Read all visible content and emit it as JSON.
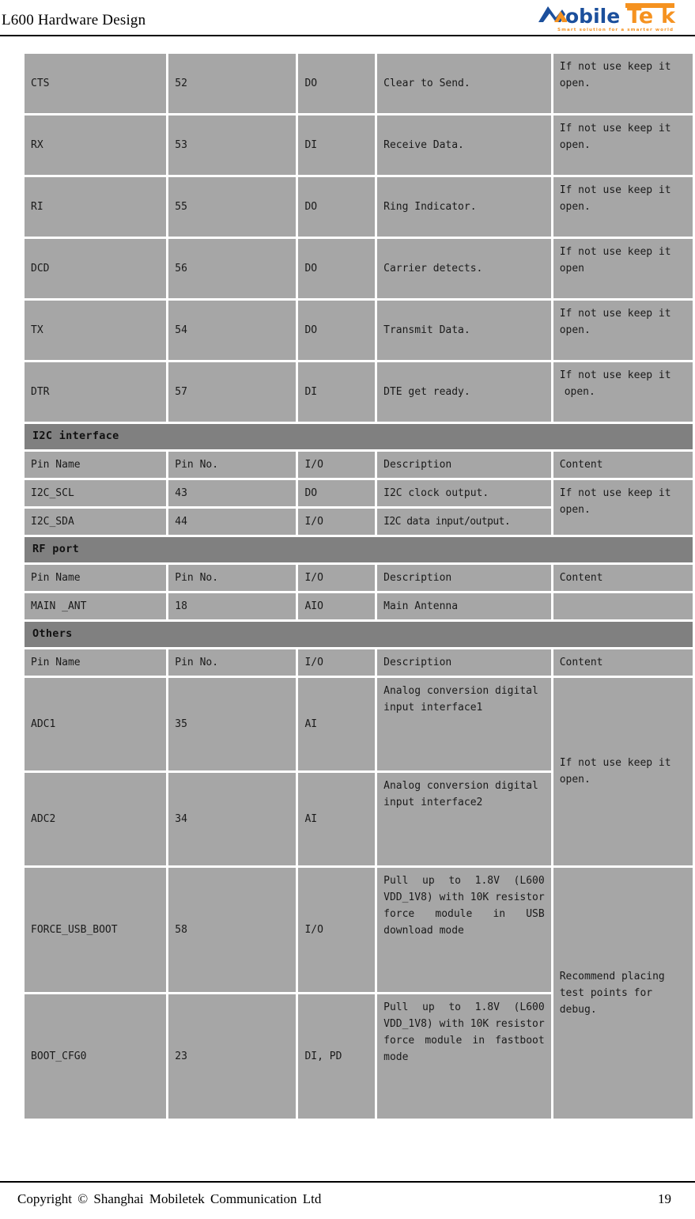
{
  "header": {
    "title": "L600 Hardware Design",
    "logo": {
      "name": "mobiletek-logo",
      "word_mobile": "obile",
      "word_tek": "Tek",
      "tagline": "Smart solution for a smarter world",
      "color_blue": "#1b4f9c",
      "color_orange": "#f59220"
    }
  },
  "table": {
    "columns": [
      "Pin Name",
      "Pin No.",
      "I/O",
      "Description",
      "Content"
    ],
    "uart_rows": [
      {
        "pin_name": "CTS",
        "pin_no": "52",
        "io": "DO",
        "description": "Clear to Send.",
        "content": "If not use keep it open."
      },
      {
        "pin_name": "RX",
        "pin_no": "53",
        "io": "DI",
        "description": "Receive Data.",
        "content": "If not use keep it open."
      },
      {
        "pin_name": "RI",
        "pin_no": "55",
        "io": "DO",
        "description": "Ring Indicator.",
        "content": "If not use keep it open."
      },
      {
        "pin_name": "DCD",
        "pin_no": "56",
        "io": "DO",
        "description": "Carrier detects.",
        "content": "If not use keep it open"
      },
      {
        "pin_name": "TX",
        "pin_no": "54",
        "io": "DO",
        "description": "Transmit Data.",
        "content": "If not use keep it open."
      },
      {
        "pin_name": "DTR",
        "pin_no": "57",
        "io": "DI",
        "description": "DTE get ready.",
        "content_line1": "If not use keep it",
        "content_line2": "open."
      }
    ],
    "sections": [
      {
        "title": "I2C interface",
        "rows": [
          {
            "pin_name": "I2C_SCL",
            "pin_no": "43",
            "io": "DO",
            "description": "I2C clock output."
          },
          {
            "pin_name": "I2C_SDA",
            "pin_no": "44",
            "io": "I/O",
            "description": "I2C data input/output."
          }
        ],
        "merged_content": "If not use keep it open."
      },
      {
        "title": "RF port",
        "rows": [
          {
            "pin_name": "MAIN _ANT",
            "pin_no": "18",
            "io": "AIO",
            "description": "Main Antenna",
            "content": ""
          }
        ]
      },
      {
        "title": "Others",
        "rows": [
          {
            "pin_name": "ADC1",
            "pin_no": "35",
            "io": "AI",
            "description": "Analog conversion digital input interface1"
          },
          {
            "pin_name": "ADC2",
            "pin_no": "34",
            "io": "AI",
            "description": "Analog conversion digital input interface2"
          },
          {
            "pin_name": "FORCE_USB_BOOT",
            "pin_no": "58",
            "io": "I/O",
            "description": "Pull up to 1.8V (L600 VDD_1V8) with 10K resistor force module in USB download mode"
          },
          {
            "pin_name": "BOOT_CFG0",
            "pin_no": "23",
            "io": "DI, PD",
            "description": "Pull up to 1.8V (L600 VDD_1V8) with 10K resistor force module in fastboot mode"
          }
        ],
        "merged_content_adc": "If not use keep it open.",
        "merged_content_boot": "Recommend placing test points for debug."
      }
    ]
  },
  "footer": {
    "copyright": "Copyright © Shanghai Mobiletek Communication Ltd",
    "page_number": "19"
  }
}
